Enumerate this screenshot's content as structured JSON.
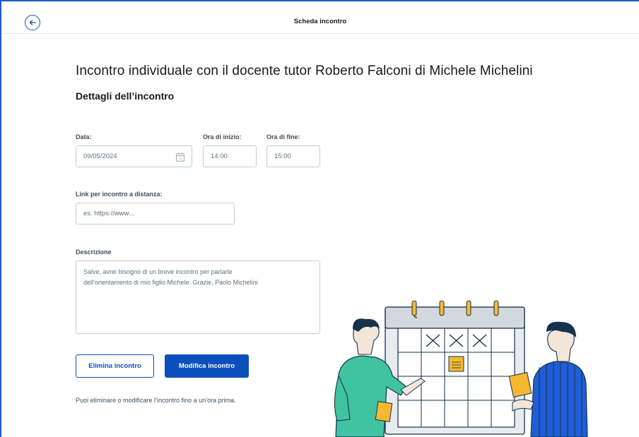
{
  "header": {
    "title": "Scheda incontro",
    "back_icon": "arrow-left-circle-icon"
  },
  "page": {
    "title": "Incontro individuale con il docente tutor Roberto Falconi di Michele Michelini",
    "subtitle": "Dettagli dell’incontro"
  },
  "form": {
    "date": {
      "label": "Data:",
      "value": "09/05/2024",
      "icon": "calendar-icon"
    },
    "start_time": {
      "label": "Ora di inizio:",
      "value": "14:00"
    },
    "end_time": {
      "label": "Ora di fine:",
      "value": "15:00"
    },
    "link": {
      "label": "Link per incontro a distanza:",
      "placeholder": "es. https://www..."
    },
    "description": {
      "label": "Descrizione",
      "value_line1": "Salve, avrei bisogno di un breve incontro per parlarle",
      "value_line2": "dell’orientamento di mio figlio Michele. Grazie, Paolo Michelini"
    }
  },
  "actions": {
    "delete_label": "Elimina incontro",
    "edit_label": "Modifica incontro"
  },
  "hint": "Puoi eliminare o modificare l’incontro fino a un’ora prima.",
  "colors": {
    "primary": "#0b4fbd",
    "text": "#17324d",
    "border": "#c5ced6"
  }
}
